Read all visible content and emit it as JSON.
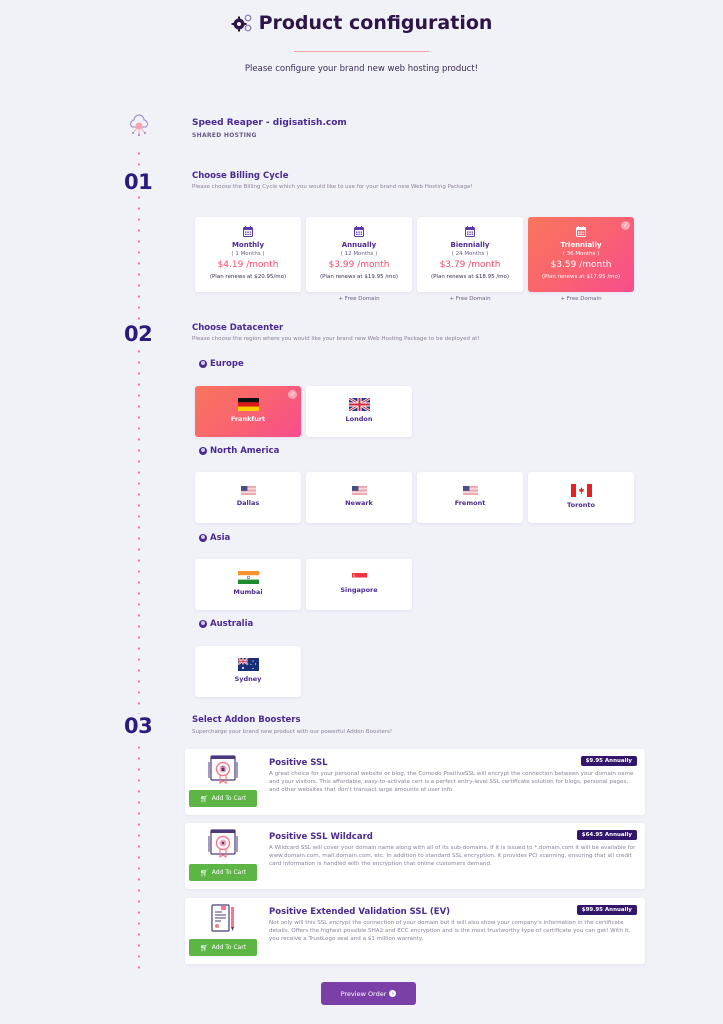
{
  "header": {
    "title": "Product configuration",
    "subtitle": "Please configure your brand new web hosting product!"
  },
  "product": {
    "name": "Speed Reaper - digisatish.com",
    "type": "SHARED HOSTING"
  },
  "steps": [
    {
      "number": "01",
      "title": "Choose Billing Cycle",
      "description": "Please choose the Billing Cycle which you would like to use for your brand new Web Hosting Package!"
    },
    {
      "number": "02",
      "title": "Choose Datacenter",
      "description": "Please choose the region where you would like your brand new Web Hosting Package to be deployed at!"
    },
    {
      "number": "03",
      "title": "Select Addon Boosters",
      "description": "Supercharge your brand new product with our powerful Addon Boosters!"
    }
  ],
  "billing_cycles": [
    {
      "name": "Monthly",
      "months": "( 1 Months )",
      "price": "$4.19 /month",
      "renew": "(Plan renews at $20.95/mo)",
      "extra": "",
      "selected": false
    },
    {
      "name": "Annually",
      "months": "( 12 Months )",
      "price": "$3.99 /month",
      "renew": "(Plan renews at $19.95 /mo)",
      "extra": "+ Free Domain",
      "selected": false
    },
    {
      "name": "Biennially",
      "months": "( 24 Months )",
      "price": "$3.79 /month",
      "renew": "(Plan renews at $18.95 /mo)",
      "extra": "+ Free Domain",
      "selected": false
    },
    {
      "name": "Triennially",
      "months": "( 36 Months )",
      "price": "$3.59 /month",
      "renew": "(Plan renews at $17.95 /mo)",
      "extra": "+ Free Domain",
      "selected": true
    }
  ],
  "regions": [
    {
      "name": "Europe",
      "datacenters": [
        {
          "city": "Frankfurt",
          "flag": "germany-flag",
          "selected": true
        },
        {
          "city": "London",
          "flag": "uk-flag",
          "selected": false
        }
      ]
    },
    {
      "name": "North America",
      "datacenters": [
        {
          "city": "Dallas",
          "flag": "usa-flag",
          "selected": false
        },
        {
          "city": "Newark",
          "flag": "usa-flag",
          "selected": false
        },
        {
          "city": "Fremont",
          "flag": "usa-flag",
          "selected": false
        },
        {
          "city": "Toronto",
          "flag": "canada-flag",
          "selected": false
        }
      ]
    },
    {
      "name": "Asia",
      "datacenters": [
        {
          "city": "Mumbai",
          "flag": "india-flag",
          "selected": false
        },
        {
          "city": "Singapore",
          "flag": "singapore-flag",
          "selected": false
        }
      ]
    },
    {
      "name": "Australia",
      "datacenters": [
        {
          "city": "Sydney",
          "flag": "australia-flag",
          "selected": false
        }
      ]
    }
  ],
  "addons": [
    {
      "title": "Positive SSL",
      "price": "$9.95 Annually",
      "description": "A great choice for your personal website or blog, the Comodo PositiveSSL will encrypt the connection between your domain name and your visitors. This affordable, easy-to-activate cert is a perfect entry-level SSL certificate solution for blogs, personal pages, and other websites that don't transact large amounts of user info.",
      "button": "Add To Cart"
    },
    {
      "title": "Positive SSL Wildcard",
      "price": "$64.95 Annually",
      "description": "A Wildcard SSL will cover your domain name along with all of its sub-domains. If it is issued to *.domain.com it will be available for www.domain.com, mail.domain.com, etc. In addition to standard SSL encryption, it provides PCI scanning, ensuring that all credit card information is handled with the encryption that online customers demand.",
      "button": "Add To Cart"
    },
    {
      "title": "Positive Extended Validation SSL (EV)",
      "price": "$99.95 Annually",
      "description": "Not only will this SSL encrypt the connection of your domain but it will also show your company's information in the certificate details. Offers the highest possible SHA2 and ECC encryption and is the most trustworthy type of certificate you can get! With it, you receive a TrustLogo seal and a $1 million warranty.",
      "button": "Add To Cart"
    }
  ],
  "footer": {
    "preview_button": "Preview Order"
  },
  "colors": {
    "accent_gradient_start": "#f9765d",
    "accent_gradient_end": "#f74d8d",
    "primary": "#4a2a91",
    "cart_green": "#5db546",
    "preview_purple": "#7b3fa8"
  }
}
